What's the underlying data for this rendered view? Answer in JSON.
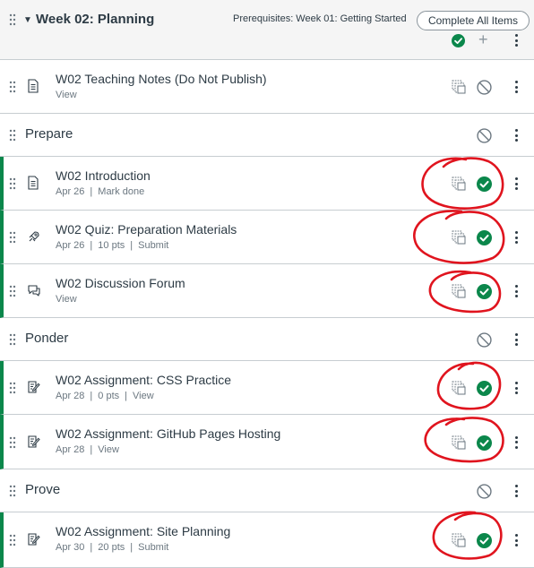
{
  "module": {
    "title": "Week 02: Planning",
    "prerequisites": "Prerequisites: Week 01: Getting Started",
    "complete_all_label": "Complete All Items"
  },
  "items": [
    {
      "kind": "item",
      "icon": "page-icon",
      "title": "W02 Teaching Notes (Do Not Publish)",
      "meta": [
        "View"
      ],
      "published": false
    },
    {
      "kind": "subheader",
      "title": "Prepare",
      "published": false
    },
    {
      "kind": "item",
      "icon": "page-icon",
      "title": "W02 Introduction",
      "meta": [
        "Apr 26",
        "Mark done"
      ],
      "published": true
    },
    {
      "kind": "item",
      "icon": "quiz-icon",
      "title": "W02 Quiz: Preparation Materials",
      "meta": [
        "Apr 26",
        "10 pts",
        "Submit"
      ],
      "published": true
    },
    {
      "kind": "item",
      "icon": "discussion-icon",
      "title": "W02 Discussion Forum",
      "meta": [
        "View"
      ],
      "published": true
    },
    {
      "kind": "subheader",
      "title": "Ponder",
      "published": false
    },
    {
      "kind": "item",
      "icon": "assignment-icon",
      "title": "W02 Assignment: CSS Practice",
      "meta": [
        "Apr 28",
        "0 pts",
        "View"
      ],
      "published": true
    },
    {
      "kind": "item",
      "icon": "assignment-icon",
      "title": "W02 Assignment: GitHub Pages Hosting",
      "meta": [
        "Apr 28",
        "View"
      ],
      "published": true
    },
    {
      "kind": "subheader",
      "title": "Prove",
      "published": false
    },
    {
      "kind": "item",
      "icon": "assignment-icon",
      "title": "W02 Assignment: Site Planning",
      "meta": [
        "Apr 30",
        "20 pts",
        "Submit"
      ],
      "published": true
    }
  ],
  "colors": {
    "published_green": "#0b874b",
    "text": "#2d3b45",
    "meta": "#6b7780",
    "border": "#c7cdd1",
    "annotation_red": "#e0141e"
  }
}
